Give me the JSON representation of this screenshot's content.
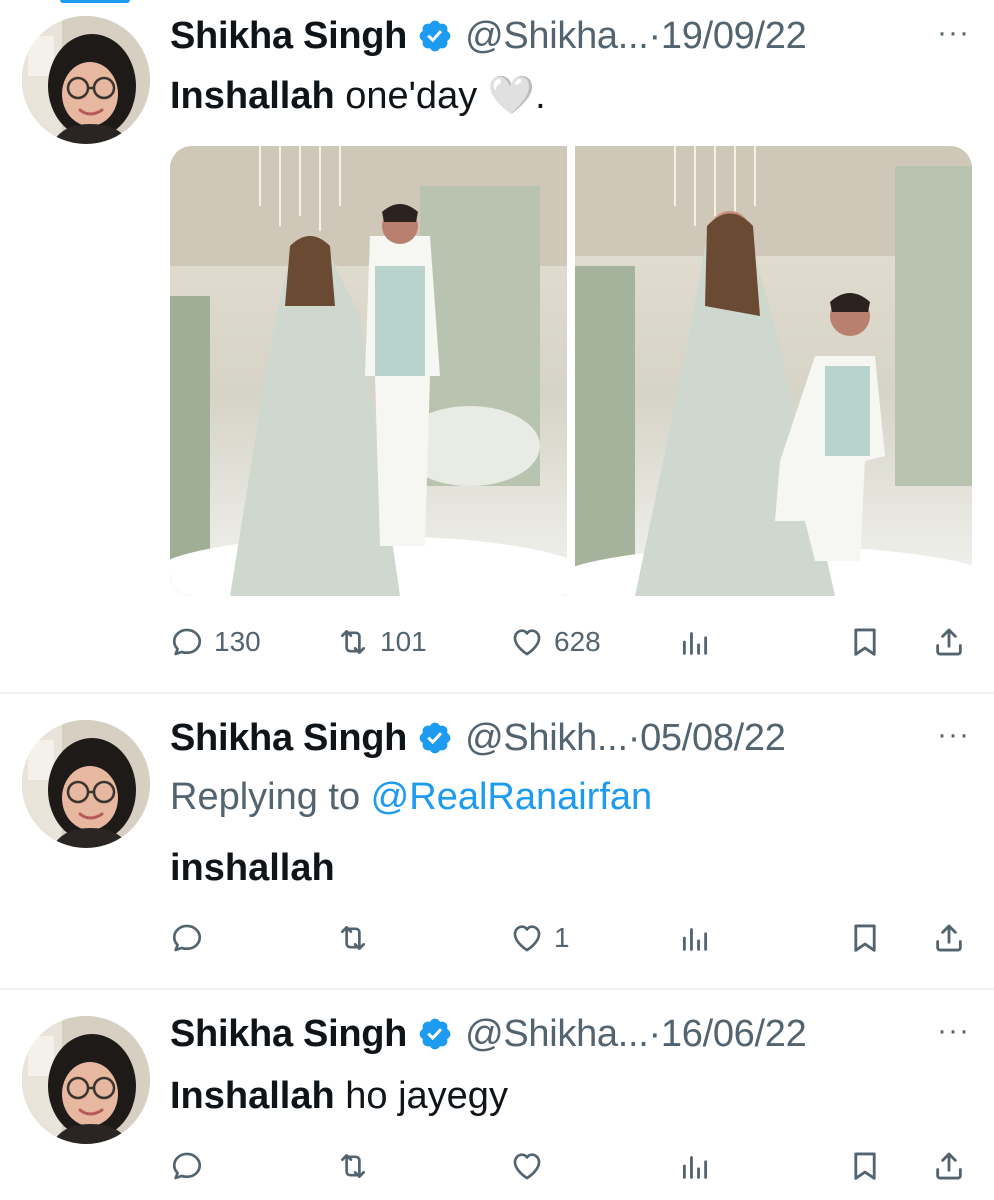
{
  "tweets": [
    {
      "name": "Shikha Singh",
      "handle": "@Shikha...",
      "separator": "·",
      "date": "19/09/22",
      "more": "···",
      "text_bold": "Inshallah",
      "text_rest": " one'day 🤍.",
      "reply_label": "",
      "reply_mention": "",
      "has_media": true,
      "counts": {
        "reply": "130",
        "retweet": "101",
        "like": "628"
      }
    },
    {
      "name": "Shikha Singh",
      "handle": "@Shikh...",
      "separator": "·",
      "date": "05/08/22",
      "more": "···",
      "reply_label": "Replying to ",
      "reply_mention": "@RealRanairfan",
      "text_bold": "inshallah",
      "text_rest": "",
      "has_media": false,
      "counts": {
        "reply": "",
        "retweet": "",
        "like": "1"
      }
    },
    {
      "name": "Shikha Singh",
      "handle": "@Shikha...",
      "separator": "·",
      "date": "16/06/22",
      "more": "···",
      "text_bold": "Inshallah",
      "text_rest": " ho jayegy",
      "reply_label": "",
      "reply_mention": "",
      "has_media": false,
      "counts": {
        "reply": "",
        "retweet": "",
        "like": ""
      }
    }
  ],
  "icons": {
    "verified": "verified-badge-icon",
    "reply": "reply-icon",
    "retweet": "retweet-icon",
    "like": "heart-icon",
    "views": "views-bar-chart-icon",
    "bookmark": "bookmark-icon",
    "share": "share-icon",
    "more": "more-dots-icon"
  },
  "colors": {
    "accent": "#1d9bf0",
    "secondary_text": "#536471",
    "primary_text": "#0f1419",
    "divider": "#eff3f4"
  }
}
